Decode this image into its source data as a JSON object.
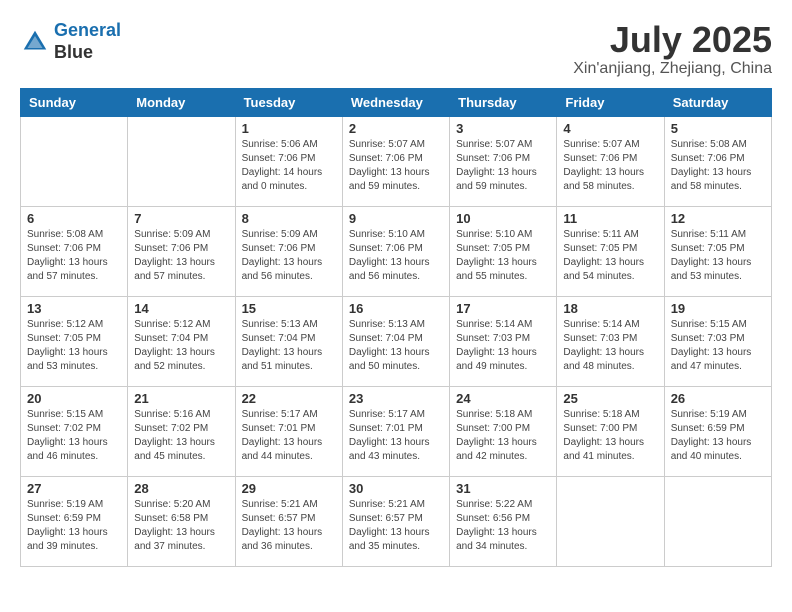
{
  "header": {
    "logo_line1": "General",
    "logo_line2": "Blue",
    "month_year": "July 2025",
    "location": "Xin'anjiang, Zhejiang, China"
  },
  "weekdays": [
    "Sunday",
    "Monday",
    "Tuesday",
    "Wednesday",
    "Thursday",
    "Friday",
    "Saturday"
  ],
  "weeks": [
    [
      {
        "day": "",
        "info": ""
      },
      {
        "day": "",
        "info": ""
      },
      {
        "day": "1",
        "info": "Sunrise: 5:06 AM\nSunset: 7:06 PM\nDaylight: 14 hours\nand 0 minutes."
      },
      {
        "day": "2",
        "info": "Sunrise: 5:07 AM\nSunset: 7:06 PM\nDaylight: 13 hours\nand 59 minutes."
      },
      {
        "day": "3",
        "info": "Sunrise: 5:07 AM\nSunset: 7:06 PM\nDaylight: 13 hours\nand 59 minutes."
      },
      {
        "day": "4",
        "info": "Sunrise: 5:07 AM\nSunset: 7:06 PM\nDaylight: 13 hours\nand 58 minutes."
      },
      {
        "day": "5",
        "info": "Sunrise: 5:08 AM\nSunset: 7:06 PM\nDaylight: 13 hours\nand 58 minutes."
      }
    ],
    [
      {
        "day": "6",
        "info": "Sunrise: 5:08 AM\nSunset: 7:06 PM\nDaylight: 13 hours\nand 57 minutes."
      },
      {
        "day": "7",
        "info": "Sunrise: 5:09 AM\nSunset: 7:06 PM\nDaylight: 13 hours\nand 57 minutes."
      },
      {
        "day": "8",
        "info": "Sunrise: 5:09 AM\nSunset: 7:06 PM\nDaylight: 13 hours\nand 56 minutes."
      },
      {
        "day": "9",
        "info": "Sunrise: 5:10 AM\nSunset: 7:06 PM\nDaylight: 13 hours\nand 56 minutes."
      },
      {
        "day": "10",
        "info": "Sunrise: 5:10 AM\nSunset: 7:05 PM\nDaylight: 13 hours\nand 55 minutes."
      },
      {
        "day": "11",
        "info": "Sunrise: 5:11 AM\nSunset: 7:05 PM\nDaylight: 13 hours\nand 54 minutes."
      },
      {
        "day": "12",
        "info": "Sunrise: 5:11 AM\nSunset: 7:05 PM\nDaylight: 13 hours\nand 53 minutes."
      }
    ],
    [
      {
        "day": "13",
        "info": "Sunrise: 5:12 AM\nSunset: 7:05 PM\nDaylight: 13 hours\nand 53 minutes."
      },
      {
        "day": "14",
        "info": "Sunrise: 5:12 AM\nSunset: 7:04 PM\nDaylight: 13 hours\nand 52 minutes."
      },
      {
        "day": "15",
        "info": "Sunrise: 5:13 AM\nSunset: 7:04 PM\nDaylight: 13 hours\nand 51 minutes."
      },
      {
        "day": "16",
        "info": "Sunrise: 5:13 AM\nSunset: 7:04 PM\nDaylight: 13 hours\nand 50 minutes."
      },
      {
        "day": "17",
        "info": "Sunrise: 5:14 AM\nSunset: 7:03 PM\nDaylight: 13 hours\nand 49 minutes."
      },
      {
        "day": "18",
        "info": "Sunrise: 5:14 AM\nSunset: 7:03 PM\nDaylight: 13 hours\nand 48 minutes."
      },
      {
        "day": "19",
        "info": "Sunrise: 5:15 AM\nSunset: 7:03 PM\nDaylight: 13 hours\nand 47 minutes."
      }
    ],
    [
      {
        "day": "20",
        "info": "Sunrise: 5:15 AM\nSunset: 7:02 PM\nDaylight: 13 hours\nand 46 minutes."
      },
      {
        "day": "21",
        "info": "Sunrise: 5:16 AM\nSunset: 7:02 PM\nDaylight: 13 hours\nand 45 minutes."
      },
      {
        "day": "22",
        "info": "Sunrise: 5:17 AM\nSunset: 7:01 PM\nDaylight: 13 hours\nand 44 minutes."
      },
      {
        "day": "23",
        "info": "Sunrise: 5:17 AM\nSunset: 7:01 PM\nDaylight: 13 hours\nand 43 minutes."
      },
      {
        "day": "24",
        "info": "Sunrise: 5:18 AM\nSunset: 7:00 PM\nDaylight: 13 hours\nand 42 minutes."
      },
      {
        "day": "25",
        "info": "Sunrise: 5:18 AM\nSunset: 7:00 PM\nDaylight: 13 hours\nand 41 minutes."
      },
      {
        "day": "26",
        "info": "Sunrise: 5:19 AM\nSunset: 6:59 PM\nDaylight: 13 hours\nand 40 minutes."
      }
    ],
    [
      {
        "day": "27",
        "info": "Sunrise: 5:19 AM\nSunset: 6:59 PM\nDaylight: 13 hours\nand 39 minutes."
      },
      {
        "day": "28",
        "info": "Sunrise: 5:20 AM\nSunset: 6:58 PM\nDaylight: 13 hours\nand 37 minutes."
      },
      {
        "day": "29",
        "info": "Sunrise: 5:21 AM\nSunset: 6:57 PM\nDaylight: 13 hours\nand 36 minutes."
      },
      {
        "day": "30",
        "info": "Sunrise: 5:21 AM\nSunset: 6:57 PM\nDaylight: 13 hours\nand 35 minutes."
      },
      {
        "day": "31",
        "info": "Sunrise: 5:22 AM\nSunset: 6:56 PM\nDaylight: 13 hours\nand 34 minutes."
      },
      {
        "day": "",
        "info": ""
      },
      {
        "day": "",
        "info": ""
      }
    ]
  ]
}
